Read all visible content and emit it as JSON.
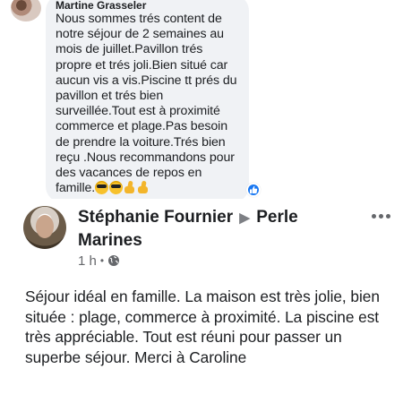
{
  "comment": {
    "author": "Martine Grasseler",
    "text": "Nous sommes trés content de notre séjour de 2 semaines au mois de juillet.Pavillon trés propre et trés joli.Bien situé car aucun vis a vis.Piscine tt prés du pavillon et trés bien surveillée.Tout est à proximité commerce et plage.Pas besoin de prendre la voiture.Trés bien reçu .Nous recommandons pour des vacances de repos en famille.",
    "emojis": [
      "smiling-face-with-sunglasses-icon",
      "smiling-face-with-sunglasses-icon",
      "thumbs-up-icon",
      "thumbs-up-icon"
    ],
    "reaction": "like-icon"
  },
  "post": {
    "author": "Stéphanie Fournier",
    "separator_icon": "right-triangle-icon",
    "page": "Perle Marines",
    "time": "1 h",
    "dot": "•",
    "audience_icon": "globe-icon",
    "text": "Séjour idéal en famille. La maison est très jolie, bien située  : plage, commerce à proximité. La piscine est très appréciable. Tout est réuni pour passer un superbe séjour. Merci à Caroline"
  },
  "colors": {
    "bubble_bg": "#f0f2f5",
    "text": "#1c1e21",
    "secondary_text": "#65676b",
    "like_blue": "#1877f2"
  }
}
